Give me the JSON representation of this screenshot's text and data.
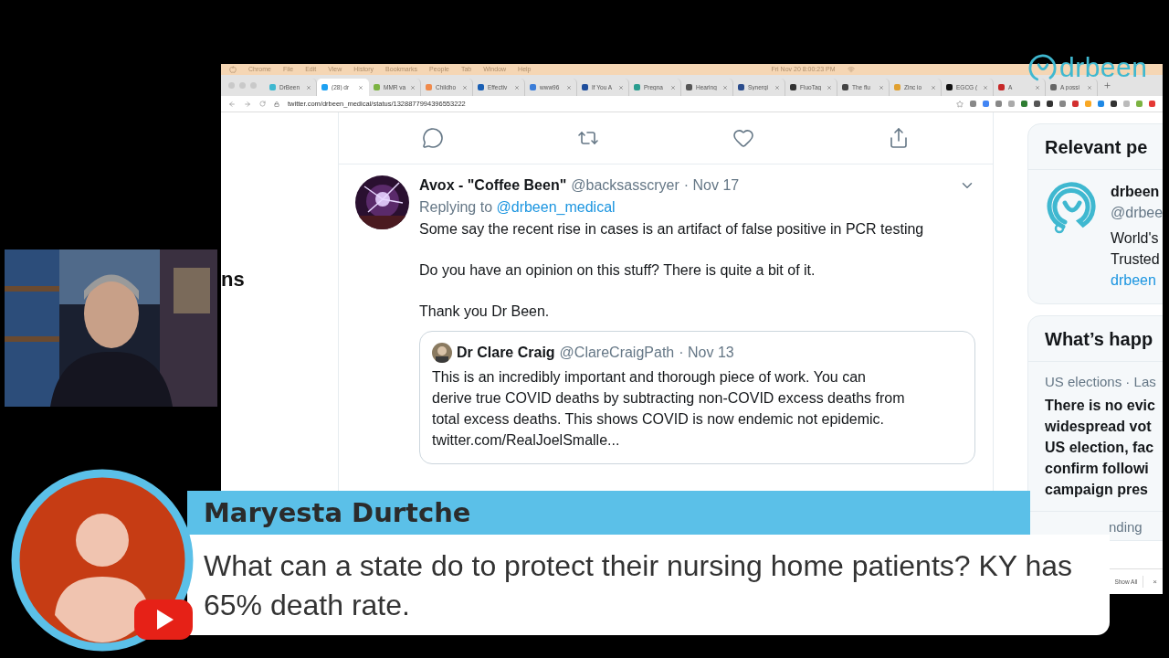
{
  "menu_bar": {
    "items": [
      "Chrome",
      "File",
      "Edit",
      "View",
      "History",
      "Bookmarks",
      "People",
      "Tab",
      "Window",
      "Help"
    ],
    "clock": "Fri Nov 20 8:00:23 PM"
  },
  "tabs": [
    {
      "label": "DrBeen",
      "selected": false,
      "color": "#3fb8d0"
    },
    {
      "label": "(28) dr",
      "selected": true,
      "color": "#1da1f2"
    },
    {
      "label": "MMR va",
      "selected": false,
      "color": "#7cb342"
    },
    {
      "label": "Childho",
      "selected": false,
      "color": "#f08a4b"
    },
    {
      "label": "Effectiv",
      "selected": false,
      "color": "#1a5fb4"
    },
    {
      "label": "www96",
      "selected": false,
      "color": "#3b7dd8"
    },
    {
      "label": "If You A",
      "selected": false,
      "color": "#1f4e9c"
    },
    {
      "label": "Pregna",
      "selected": false,
      "color": "#2a9d8f"
    },
    {
      "label": "Hearing",
      "selected": false,
      "color": "#555555"
    },
    {
      "label": "Synergi",
      "selected": false,
      "color": "#2b4c8c"
    },
    {
      "label": "FluoTag",
      "selected": false,
      "color": "#333333"
    },
    {
      "label": "The flu",
      "selected": false,
      "color": "#444444"
    },
    {
      "label": "Zinc io",
      "selected": false,
      "color": "#e0a030"
    },
    {
      "label": "EGCG (",
      "selected": false,
      "color": "#111111"
    },
    {
      "label": "A",
      "selected": false,
      "color": "#c62828"
    },
    {
      "label": "A possi",
      "selected": false,
      "color": "#666666"
    }
  ],
  "address_bar": {
    "url": "twitter.com/drbeen_medical/status/1328877994396553222"
  },
  "left_fragment": "ns",
  "tweet": {
    "name": "Avox - \"Coffee Been\"",
    "handle": "@backsasscryer",
    "date": "· Nov 17",
    "replying_label": "Replying to",
    "replying_handle": "@drbeen_medical",
    "paragraphs": [
      "Some say the recent rise in cases is an artifact of false positive in PCR testing",
      "Do you have an opinion on this stuff? There is quite a bit of it.",
      "Thank you Dr Been."
    ],
    "quote": {
      "name": "Dr Clare Craig",
      "handle": "@ClareCraigPath",
      "date": "· Nov 13",
      "text": "This is an incredibly important and thorough piece of work. You can derive true COVID deaths by subtracting non-COVID excess deaths from total excess deaths. This shows COVID is now endemic not epidemic. twitter.com/RealJoelSmalle..."
    }
  },
  "relevant_people": {
    "title": "Relevant pe",
    "name": "drbeen",
    "handle": "@drbee",
    "bio_lines": [
      "World's",
      "Trusted"
    ],
    "link": "drbeen"
  },
  "whats_happening": {
    "title": "What’s happ",
    "topic": "US elections · Las",
    "headline_lines": [
      "There is no evic",
      "widespread vot",
      "US election, fac",
      "confirm followi",
      "campaign pres"
    ],
    "next": "nding"
  },
  "download_bar": {
    "show_all": "Show All",
    "close": "×"
  },
  "logo": "drbeen",
  "chat": {
    "author": "Maryesta Durtche",
    "message": "What can a state do to protect their nursing home patients? KY has 65% death rate."
  }
}
